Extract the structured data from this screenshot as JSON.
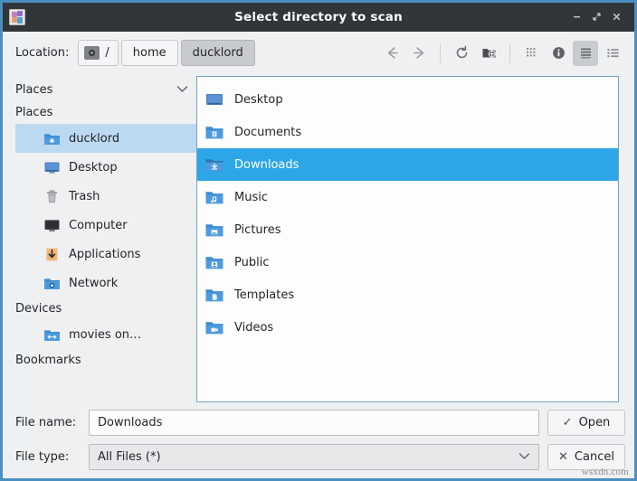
{
  "window": {
    "title": "Select directory to scan",
    "app_icon": "app-icon",
    "controls": [
      {
        "name": "minimize",
        "glyph": "minimize-icon"
      },
      {
        "name": "restore",
        "glyph": "restore-icon"
      },
      {
        "name": "close",
        "glyph": "close-icon"
      }
    ]
  },
  "toolbar": {
    "location_label": "Location:",
    "breadcrumbs": [
      {
        "label": "/",
        "icon": "drive-icon",
        "active": false
      },
      {
        "label": "home",
        "icon": "",
        "active": false
      },
      {
        "label": "ducklord",
        "icon": "",
        "active": true
      }
    ],
    "buttons": [
      {
        "name": "back-icon",
        "title": "Back"
      },
      {
        "name": "forward-icon",
        "title": "Forward"
      },
      {
        "name": "reload-icon",
        "title": "Reload"
      },
      {
        "name": "new-folder-icon",
        "title": "New Folder"
      },
      {
        "name": "icon-view-icon",
        "title": "Icon View"
      },
      {
        "name": "info-icon",
        "title": "Show Information"
      },
      {
        "name": "compact-view-icon",
        "title": "Compact View"
      },
      {
        "name": "detail-view-icon",
        "title": "Detailed View"
      }
    ]
  },
  "sidebar": {
    "header": {
      "label": "Places",
      "chevron": "chevron-down-icon"
    },
    "groups": [
      {
        "label": "Places",
        "items": [
          {
            "label": "ducklord",
            "icon": "home-folder-icon",
            "selected": true
          },
          {
            "label": "Desktop",
            "icon": "desktop-icon",
            "selected": false
          },
          {
            "label": "Trash",
            "icon": "trash-icon",
            "selected": false
          },
          {
            "label": "Computer",
            "icon": "computer-icon",
            "selected": false
          },
          {
            "label": "Applications",
            "icon": "applications-icon",
            "selected": false
          },
          {
            "label": "Network",
            "icon": "network-folder-icon",
            "selected": false
          }
        ]
      },
      {
        "label": "Devices",
        "items": [
          {
            "label": "movies on…",
            "icon": "remote-folder-icon",
            "selected": false
          }
        ]
      },
      {
        "label": "Bookmarks",
        "items": []
      }
    ]
  },
  "file_list": [
    {
      "name": "Desktop",
      "icon": "desktop-folder-icon",
      "selected": false
    },
    {
      "name": "Documents",
      "icon": "documents-folder-icon",
      "selected": false
    },
    {
      "name": "Downloads",
      "icon": "downloads-folder-icon",
      "selected": true
    },
    {
      "name": "Music",
      "icon": "music-folder-icon",
      "selected": false
    },
    {
      "name": "Pictures",
      "icon": "pictures-folder-icon",
      "selected": false
    },
    {
      "name": "Public",
      "icon": "public-folder-icon",
      "selected": false
    },
    {
      "name": "Templates",
      "icon": "templates-folder-icon",
      "selected": false
    },
    {
      "name": "Videos",
      "icon": "videos-folder-icon",
      "selected": false
    }
  ],
  "footer": {
    "filename_label": "File name:",
    "filename_value": "Downloads",
    "filename_placeholder": "",
    "filetype_label": "File type:",
    "filetype_value": "All Files (*)",
    "open_button": "Open",
    "open_glyph": "✓",
    "cancel_button": "Cancel",
    "cancel_glyph": "✕"
  },
  "watermark": "wsxdn.com",
  "colors": {
    "titlebar": "#31363b",
    "window_border": "#4a8fc0",
    "body_bg": "#eff0f1",
    "selection_strong": "#2da6e8",
    "selection_soft": "#bcd9f2",
    "pane_border": "#6ea4c4"
  }
}
